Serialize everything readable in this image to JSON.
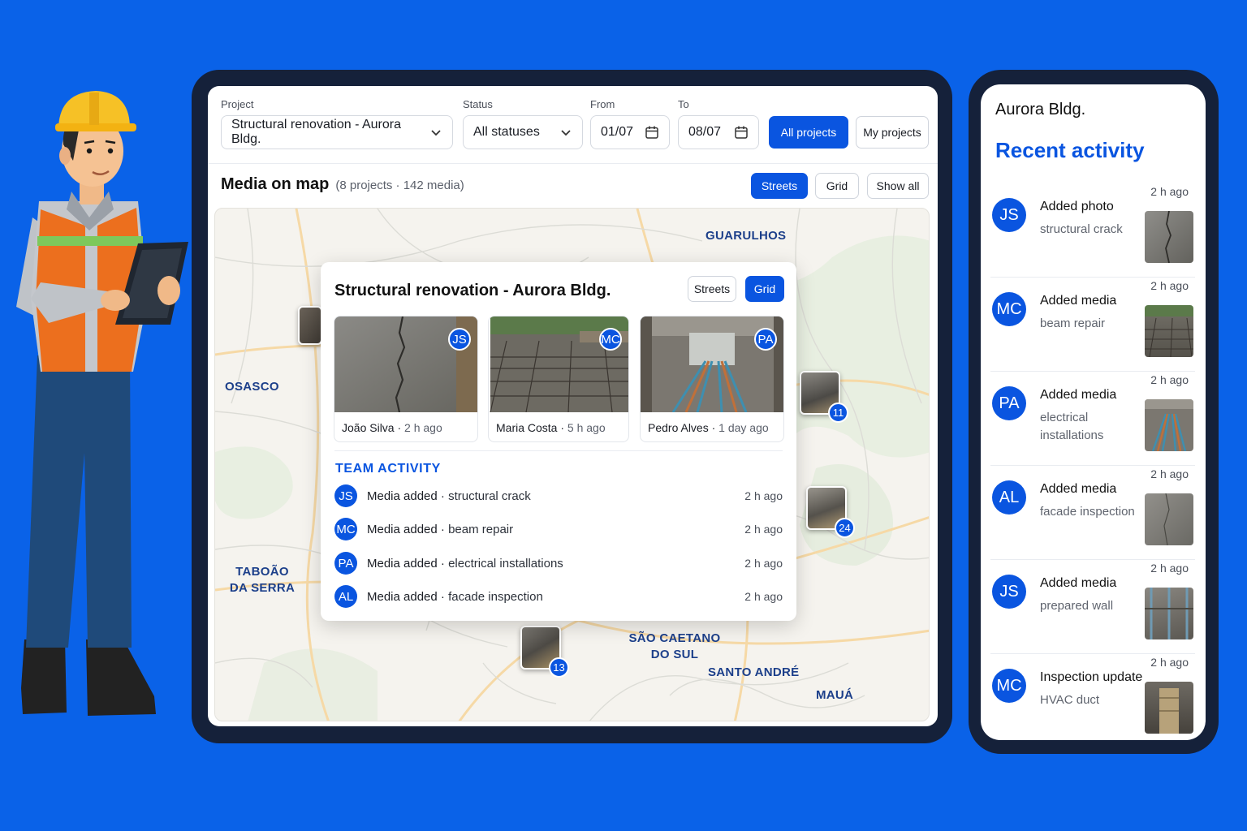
{
  "filters": {
    "project_label": "Project",
    "project_value": "Structural renovation - Aurora Bldg.",
    "status_label": "Status",
    "status_value": "All statuses",
    "from_label": "From",
    "from_value": "01/07",
    "to_label": "To",
    "to_value": "08/07",
    "all_projects": "All projects",
    "my_projects": "My projects"
  },
  "map_header": {
    "title": "Media on map",
    "subtitle": "(8 projects · 142 media)",
    "streets": "Streets",
    "grid": "Grid",
    "show_all": "Show all"
  },
  "map": {
    "cities": [
      "GUARULHOS",
      "OSASCO",
      "TABOÃO DA SERRA",
      "SÃO CAETANO DO SUL",
      "SANTO ANDRÉ",
      "MAUÁ"
    ],
    "clusters": [
      {
        "count": "11"
      },
      {
        "count": "24"
      },
      {
        "count": "13"
      }
    ]
  },
  "popup": {
    "title": "Structural renovation - Aurora Bldg.",
    "streets": "Streets",
    "grid": "Grid",
    "cards": [
      {
        "initials": "JS",
        "name": "João Silva",
        "time": "2 h ago"
      },
      {
        "initials": "MC",
        "name": "Maria Costa",
        "time": "5 h ago"
      },
      {
        "initials": "PA",
        "name": "Pedro Alves",
        "time": "1 day ago"
      }
    ],
    "team_title": "TEAM ACTIVITY",
    "activity": [
      {
        "initials": "JS",
        "action": "Media added",
        "detail": "structural crack",
        "time": "2 h ago"
      },
      {
        "initials": "MC",
        "action": "Media added",
        "detail": "beam repair",
        "time": "2 h ago"
      },
      {
        "initials": "PA",
        "action": "Media added",
        "detail": "electrical installations",
        "time": "2 h ago"
      },
      {
        "initials": "AL",
        "action": "Media added",
        "detail": "facade inspection",
        "time": "2 h ago"
      }
    ]
  },
  "phone": {
    "project": "Aurora Bldg.",
    "heading": "Recent activity",
    "items": [
      {
        "initials": "JS",
        "action": "Added photo",
        "detail": "structural crack",
        "time": "2 h ago"
      },
      {
        "initials": "MC",
        "action": "Added media",
        "detail": "beam repair",
        "time": "2 h ago"
      },
      {
        "initials": "PA",
        "action": "Added media",
        "detail": "electrical installations",
        "time": "2 h ago"
      },
      {
        "initials": "AL",
        "action": "Added media",
        "detail": "facade inspection",
        "time": "2 h ago"
      },
      {
        "initials": "JS",
        "action": "Added media",
        "detail": "prepared wall",
        "time": "2 h ago"
      },
      {
        "initials": "MC",
        "action": "Inspection update",
        "detail": "HVAC duct",
        "time": "2 h ago"
      }
    ]
  },
  "colors": {
    "background": "#0a62e8",
    "accent": "#0a55e0",
    "device_frame": "#15213a"
  }
}
